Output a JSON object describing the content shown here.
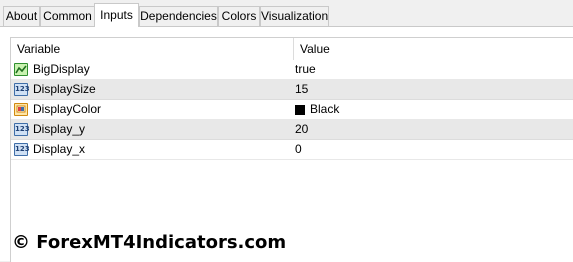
{
  "tabs": [
    "About",
    "Common",
    "Inputs",
    "Dependencies",
    "Colors",
    "Visualization"
  ],
  "active_tab": "Inputs",
  "table": {
    "headers": {
      "variable": "Variable",
      "value": "Value"
    },
    "rows": [
      {
        "name": "BigDisplay",
        "value": "true",
        "icon": "bool-icon"
      },
      {
        "name": "DisplaySize",
        "value": "15",
        "icon": "number-icon"
      },
      {
        "name": "DisplayColor",
        "value": "Black",
        "icon": "color-icon",
        "swatch": "#000000"
      },
      {
        "name": "Display_y",
        "value": "20",
        "icon": "number-icon"
      },
      {
        "name": "Display_x",
        "value": "0",
        "icon": "number-icon"
      }
    ]
  },
  "watermark": "© ForexMT4Indicators.com"
}
